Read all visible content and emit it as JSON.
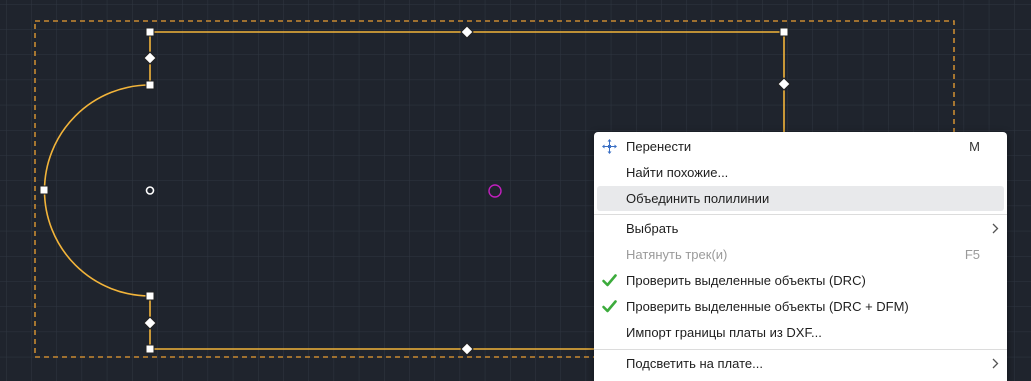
{
  "canvas": {
    "background": "#1f242d",
    "grid_color": "#2f3641",
    "outline_color": "#f2b43a",
    "selection_box_color": "#c88a32",
    "origin_marker_color": "#c21fbf"
  },
  "context_menu": {
    "items": [
      {
        "label": "Перенести",
        "shortcut": "M",
        "icon": "move-icon"
      },
      {
        "label": "Найти похожие..."
      },
      {
        "label": "Объединить полилинии",
        "highlighted": true
      },
      {
        "label": "Выбрать",
        "submenu": true
      },
      {
        "label": "Натянуть трек(и)",
        "shortcut": "F5",
        "disabled": true
      },
      {
        "label": "Проверить выделенные объекты (DRC)",
        "icon": "checkmark-icon"
      },
      {
        "label": "Проверить выделенные объекты (DRC + DFM)",
        "icon": "checkmark-icon"
      },
      {
        "label": "Импорт границы платы из DXF..."
      },
      {
        "label": "Подсветить на плате...",
        "submenu": true
      }
    ]
  }
}
